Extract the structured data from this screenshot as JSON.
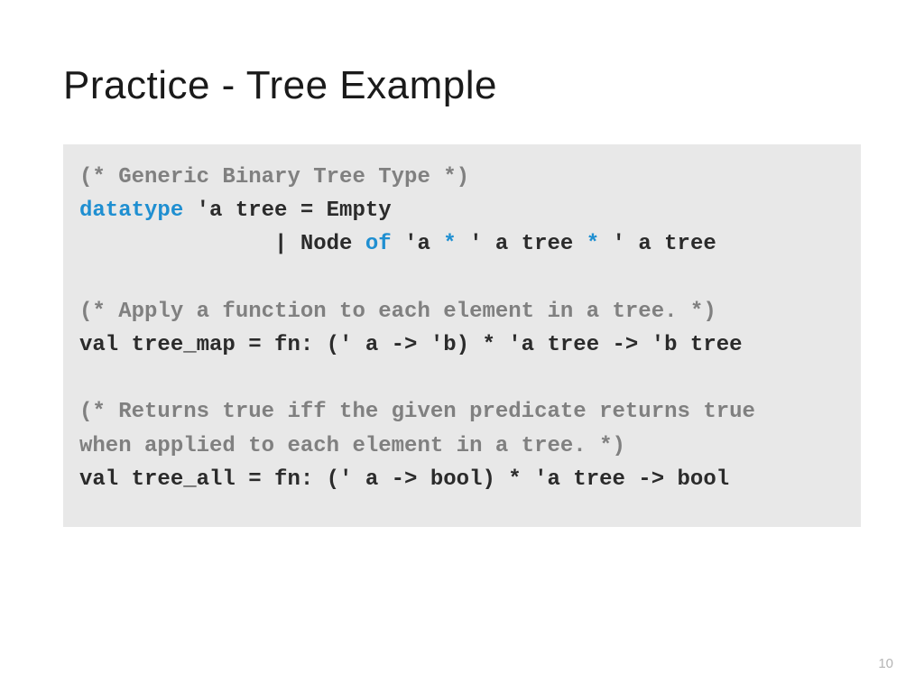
{
  "title": "Practice - Tree Example",
  "page_number": "10",
  "code": {
    "c1": "(* Generic Binary Tree Type *)",
    "l2a": "datatype",
    "l2b": " 'a tree = Empty",
    "l3a": "               | Node ",
    "l3b": "of",
    "l3c": " 'a ",
    "l3d": "*",
    "l3e": " ' a tree ",
    "l3f": "*",
    "l3g": " ' a tree",
    "c2": "(* Apply a function to each element in a tree. *)",
    "l5": "val tree_map = fn: (' a -> 'b) * 'a tree -> 'b tree",
    "c3a": "(* Returns true iff the given predicate returns true",
    "c3b": "when applied to each element in a tree. *)",
    "l8": "val tree_all = fn: (' a -> bool) * 'a tree -> bool"
  }
}
